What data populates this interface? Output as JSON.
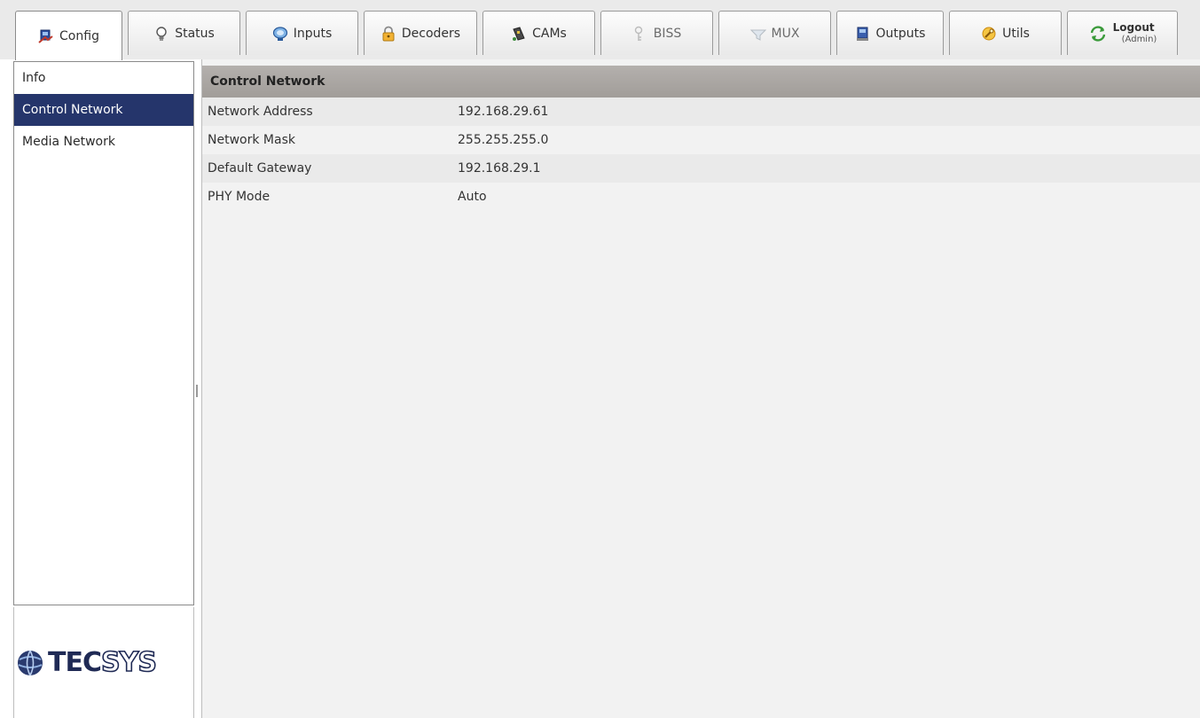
{
  "tabs": [
    {
      "id": "config",
      "label": "Config",
      "icon": "config-icon",
      "active": true
    },
    {
      "id": "status",
      "label": "Status",
      "icon": "lightbulb-icon"
    },
    {
      "id": "inputs",
      "label": "Inputs",
      "icon": "satellite-dish-icon"
    },
    {
      "id": "decoders",
      "label": "Decoders",
      "icon": "padlock-icon"
    },
    {
      "id": "cams",
      "label": "CAMs",
      "icon": "cam-card-icon"
    },
    {
      "id": "biss",
      "label": "BISS",
      "icon": "key-icon",
      "disabled": true
    },
    {
      "id": "mux",
      "label": "MUX",
      "icon": "mux-funnel-icon",
      "disabled": true
    },
    {
      "id": "outputs",
      "label": "Outputs",
      "icon": "outputs-icon"
    },
    {
      "id": "utils",
      "label": "Utils",
      "icon": "utils-wrench-icon"
    }
  ],
  "logout": {
    "label": "Logout",
    "user": "(Admin)",
    "icon": "logout-arrows-icon"
  },
  "sidebar": {
    "items": [
      {
        "label": "Info"
      },
      {
        "label": "Control Network",
        "selected": true
      },
      {
        "label": "Media Network"
      }
    ]
  },
  "logo": {
    "part1": "TEC",
    "part2": "SYS"
  },
  "panel": {
    "title": "Control Network",
    "rows": [
      {
        "label": "Network Address",
        "value": "192.168.29.61"
      },
      {
        "label": "Network Mask",
        "value": "255.255.255.0"
      },
      {
        "label": "Default Gateway",
        "value": "192.168.29.1"
      },
      {
        "label": "PHY Mode",
        "value": "Auto"
      }
    ]
  },
  "colors": {
    "selected_bg": "#25356b",
    "header_bg": "#a8a4a0",
    "logo_blue": "#1f2a55"
  }
}
